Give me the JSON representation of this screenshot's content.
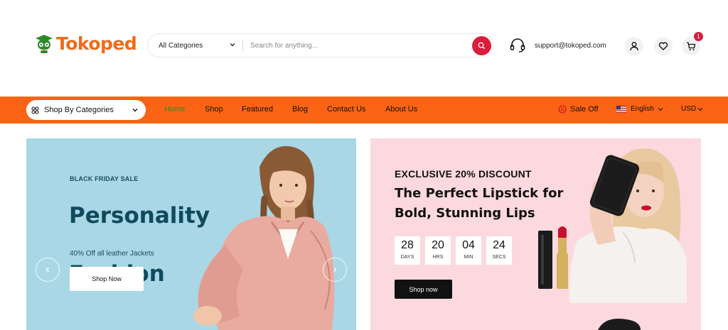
{
  "header": {
    "logo_text": "Tokoped",
    "search": {
      "category": "All Categories",
      "placeholder": "Search for anything..."
    },
    "support_email": "support@tokoped.com",
    "cart_count": "1"
  },
  "nav": {
    "shop_by_categories": "Shop By Categories",
    "links": [
      "Home",
      "Shop",
      "Featured",
      "Blog",
      "Contact Us",
      "About Us"
    ],
    "active": "Home",
    "sale_off": "Sale Off",
    "language": "English",
    "currency": "USD"
  },
  "hero_left": {
    "tag": "BLACK FRIDAY SALE",
    "title": "Personality Fashion",
    "subtitle": "40% Off all leather Jackets",
    "button": "Shop Now"
  },
  "hero_right": {
    "tag": "EXCLUSIVE 20% DISCOUNT",
    "title": "The Perfect Lipstick for Bold, Stunning Lips",
    "countdown": [
      {
        "value": "28",
        "unit": "DAYS"
      },
      {
        "value": "20",
        "unit": "HRS"
      },
      {
        "value": "04",
        "unit": "MIN"
      },
      {
        "value": "24",
        "unit": "SECS"
      }
    ],
    "button": "Shop now"
  },
  "colors": {
    "brand_orange": "#fa6414",
    "logo_orange": "#ef6a1a",
    "logo_green": "#2f8a2a",
    "accent_red": "#d61f3c",
    "banner_blue": "#a9d7e6",
    "banner_pink": "#fcd9df"
  },
  "icons": [
    "search-icon",
    "headset-icon",
    "user-icon",
    "heart-icon",
    "cart-icon",
    "grid-icon",
    "sale-icon",
    "us-flag-icon",
    "chevron-left-icon",
    "chevron-right-icon"
  ]
}
